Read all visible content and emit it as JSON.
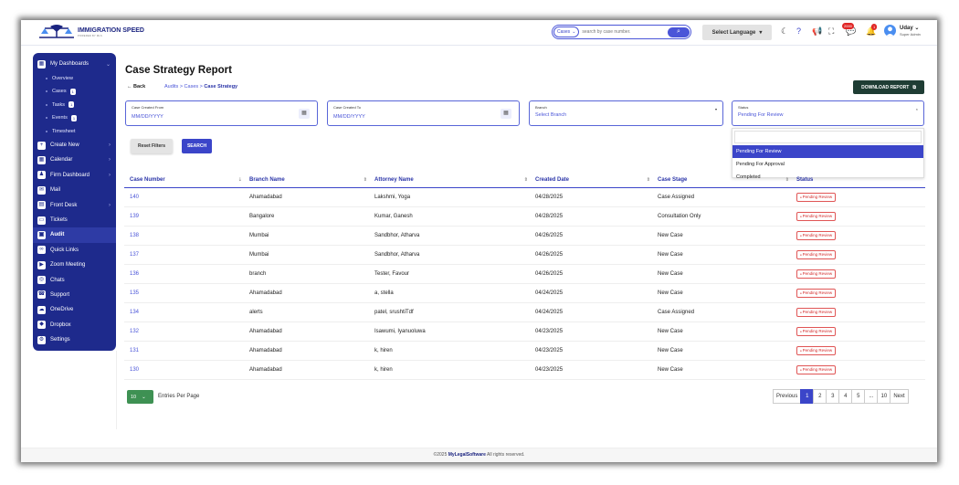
{
  "brand": {
    "name": "IMMIGRATION SPEED",
    "tagline": "POWERED BY MLS"
  },
  "header": {
    "search_scope": "Cases",
    "search_placeholder": "search by case number.",
    "language": "Select Language",
    "chat_badge": "2000",
    "notif_badge": "1",
    "user_name": "Uday",
    "user_role": "Super Admin"
  },
  "sidebar": {
    "items": [
      {
        "label": "My Dashboards",
        "icon": "grid-icon",
        "chev": "⌄"
      },
      {
        "label": "Overview",
        "sub": true
      },
      {
        "label": "Cases",
        "sub": true,
        "count": "1"
      },
      {
        "label": "Tasks",
        "sub": true,
        "count": "1"
      },
      {
        "label": "Events",
        "sub": true,
        "count": "1"
      },
      {
        "label": "Timesheet",
        "sub": true
      },
      {
        "label": "Create New",
        "icon": "plus-icon",
        "chev": "›"
      },
      {
        "label": "Calendar",
        "icon": "calendar-icon",
        "chev": "›"
      },
      {
        "label": "Firm Dashboard",
        "icon": "user-icon",
        "chev": "›"
      },
      {
        "label": "Mail",
        "icon": "mail-icon"
      },
      {
        "label": "Front Desk",
        "icon": "desk-icon",
        "chev": "›"
      },
      {
        "label": "Tickets",
        "icon": "ticket-icon"
      },
      {
        "label": "Audit",
        "icon": "audit-icon",
        "active": true
      },
      {
        "label": "Quick Links",
        "icon": "link-icon"
      },
      {
        "label": "Zoom Meeting",
        "icon": "video-icon"
      },
      {
        "label": "Chats",
        "icon": "chat-icon"
      },
      {
        "label": "Support",
        "icon": "support-icon"
      },
      {
        "label": "OneDrive",
        "icon": "cloud-icon"
      },
      {
        "label": "Dropbox",
        "icon": "dropbox-icon"
      },
      {
        "label": "Settings",
        "icon": "gear-icon"
      }
    ]
  },
  "page": {
    "title": "Case Strategy Report",
    "back": "← Back",
    "crumb_prefix": "Audits > Cases > ",
    "crumb_current": "Case Strategy",
    "download": "DOWNLOAD REPORT"
  },
  "filters": {
    "from_label": "Case Created From",
    "from_value": "MM/DD/YYYY",
    "to_label": "Case Created To",
    "to_value": "MM/DD/YYYY",
    "branch_label": "Branch",
    "branch_value": "Select Branch",
    "status_label": "Status",
    "status_value": "Pending For Review",
    "status_options": [
      "Pending For Review",
      "Pending For Approval",
      "Completed"
    ],
    "reset": "Reset Filters",
    "search": "SEARCH"
  },
  "table": {
    "headers": [
      "Case Number",
      "Branch Name",
      "Attorney Name",
      "Created Date",
      "Case Stage",
      "Status"
    ],
    "rows": [
      [
        "140",
        "Ahamadabad",
        "Lakshmi, Yoga",
        "04/28/2025",
        "Case Assigned",
        "Pending Review"
      ],
      [
        "139",
        "Bangalore",
        "Kumar, Ganesh",
        "04/28/2025",
        "Consultation Only",
        "Pending Review"
      ],
      [
        "138",
        "Mumbai",
        "Sandbhor, Atharva",
        "04/26/2025",
        "New Case",
        "Pending Review"
      ],
      [
        "137",
        "Mumbai",
        "Sandbhor, Atharva",
        "04/26/2025",
        "New Case",
        "Pending Review"
      ],
      [
        "136",
        "branch",
        "Tester, Favour",
        "04/26/2025",
        "New Case",
        "Pending Review"
      ],
      [
        "135",
        "Ahamadabad",
        "a, stella",
        "04/24/2025",
        "New Case",
        "Pending Review"
      ],
      [
        "134",
        "alerts",
        "patel, srushtiTdf",
        "04/24/2025",
        "Case Assigned",
        "Pending Review"
      ],
      [
        "132",
        "Ahamadabad",
        "Isawumi, Iyanuoluwa",
        "04/23/2025",
        "New Case",
        "Pending Review"
      ],
      [
        "131",
        "Ahamadabad",
        "k, hiren",
        "04/23/2025",
        "New Case",
        "Pending Review"
      ],
      [
        "130",
        "Ahamadabad",
        "k, hiren",
        "04/23/2025",
        "New Case",
        "Pending Review"
      ]
    ]
  },
  "pagination": {
    "per_page": "10",
    "per_page_label": "Entries Per Page",
    "pages": [
      "Previous",
      "1",
      "2",
      "3",
      "4",
      "5",
      "...",
      "10",
      "Next"
    ],
    "current": "1"
  },
  "footer": {
    "prefix": "©2025 ",
    "brand": "MyLegalSoftware",
    "suffix": " All rights reserved."
  }
}
